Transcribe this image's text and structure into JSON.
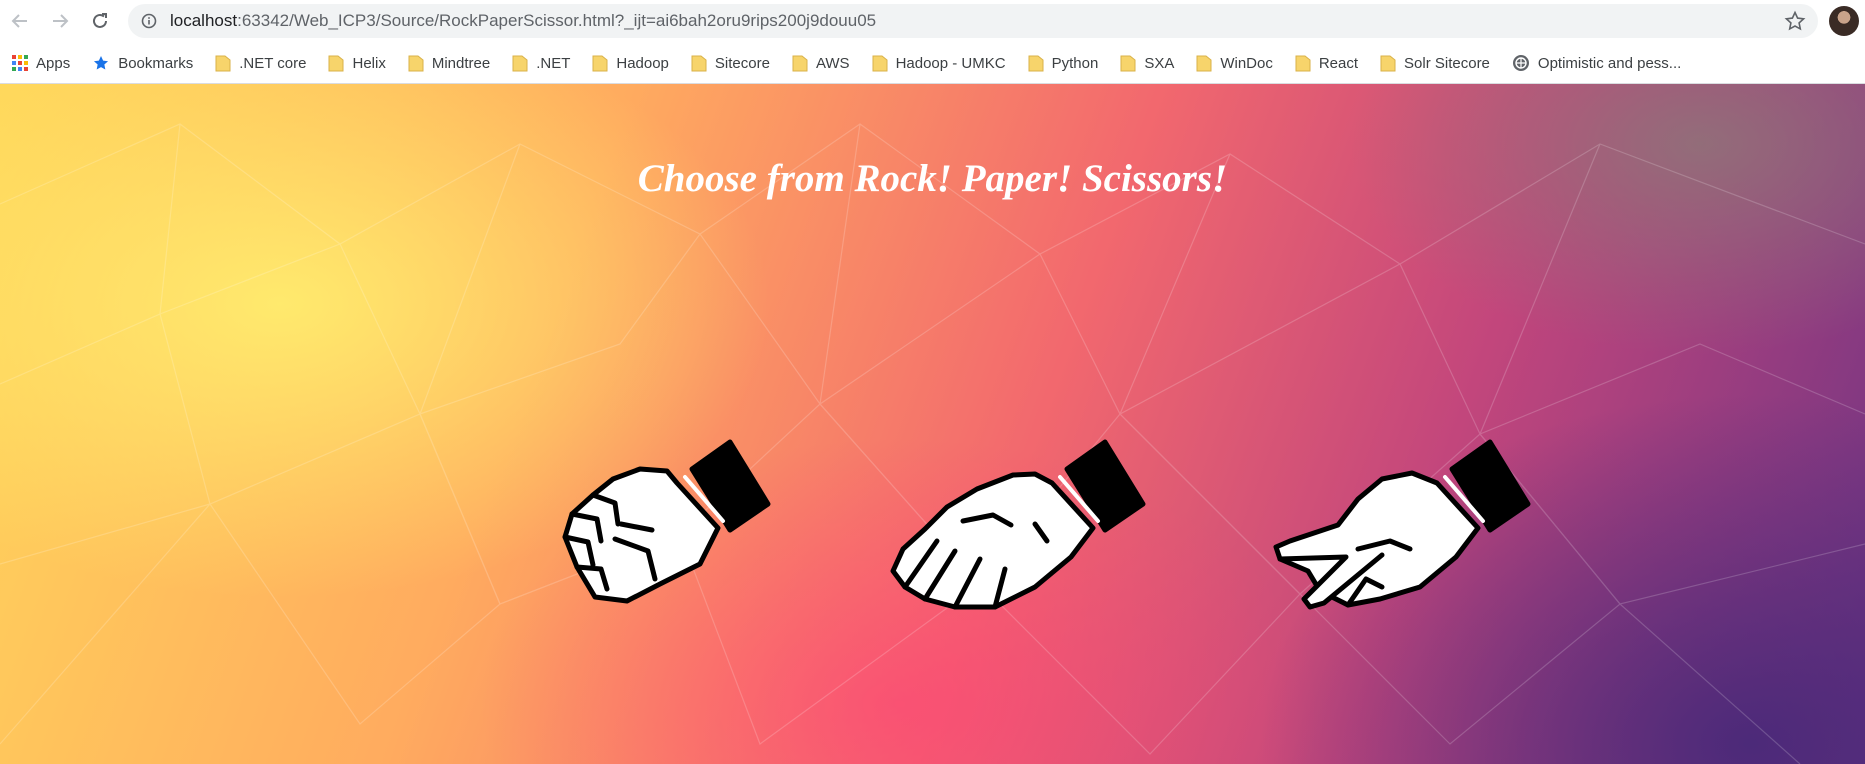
{
  "browser": {
    "url_host": "localhost",
    "url_rest": ":63342/Web_ICP3/Source/RockPaperScissor.html?_ijt=ai6bah2oru9rips200j9douu05",
    "bookmarks": [
      {
        "label": "Apps",
        "icon": "apps-icon"
      },
      {
        "label": "Bookmarks",
        "icon": "star-icon"
      },
      {
        "label": ".NET core",
        "icon": "folder-icon"
      },
      {
        "label": "Helix",
        "icon": "folder-icon"
      },
      {
        "label": "Mindtree",
        "icon": "folder-icon"
      },
      {
        "label": ".NET",
        "icon": "folder-icon"
      },
      {
        "label": "Hadoop",
        "icon": "folder-icon"
      },
      {
        "label": "Sitecore",
        "icon": "folder-icon"
      },
      {
        "label": "AWS",
        "icon": "folder-icon"
      },
      {
        "label": "Hadoop - UMKC",
        "icon": "folder-icon"
      },
      {
        "label": "Python",
        "icon": "folder-icon"
      },
      {
        "label": "SXA",
        "icon": "folder-icon"
      },
      {
        "label": "WinDoc",
        "icon": "folder-icon"
      },
      {
        "label": "React",
        "icon": "folder-icon"
      },
      {
        "label": "Solr Sitecore",
        "icon": "folder-icon"
      },
      {
        "label": "Optimistic and pess...",
        "icon": "globe-icon"
      }
    ]
  },
  "page": {
    "title": "Choose from Rock! Paper! Scissors!",
    "choices": [
      "rock",
      "paper",
      "scissors"
    ]
  },
  "colors": {
    "folder": "#f7d46b",
    "bookmark_star": "#1a73e8",
    "title_text": "#ffffff"
  }
}
